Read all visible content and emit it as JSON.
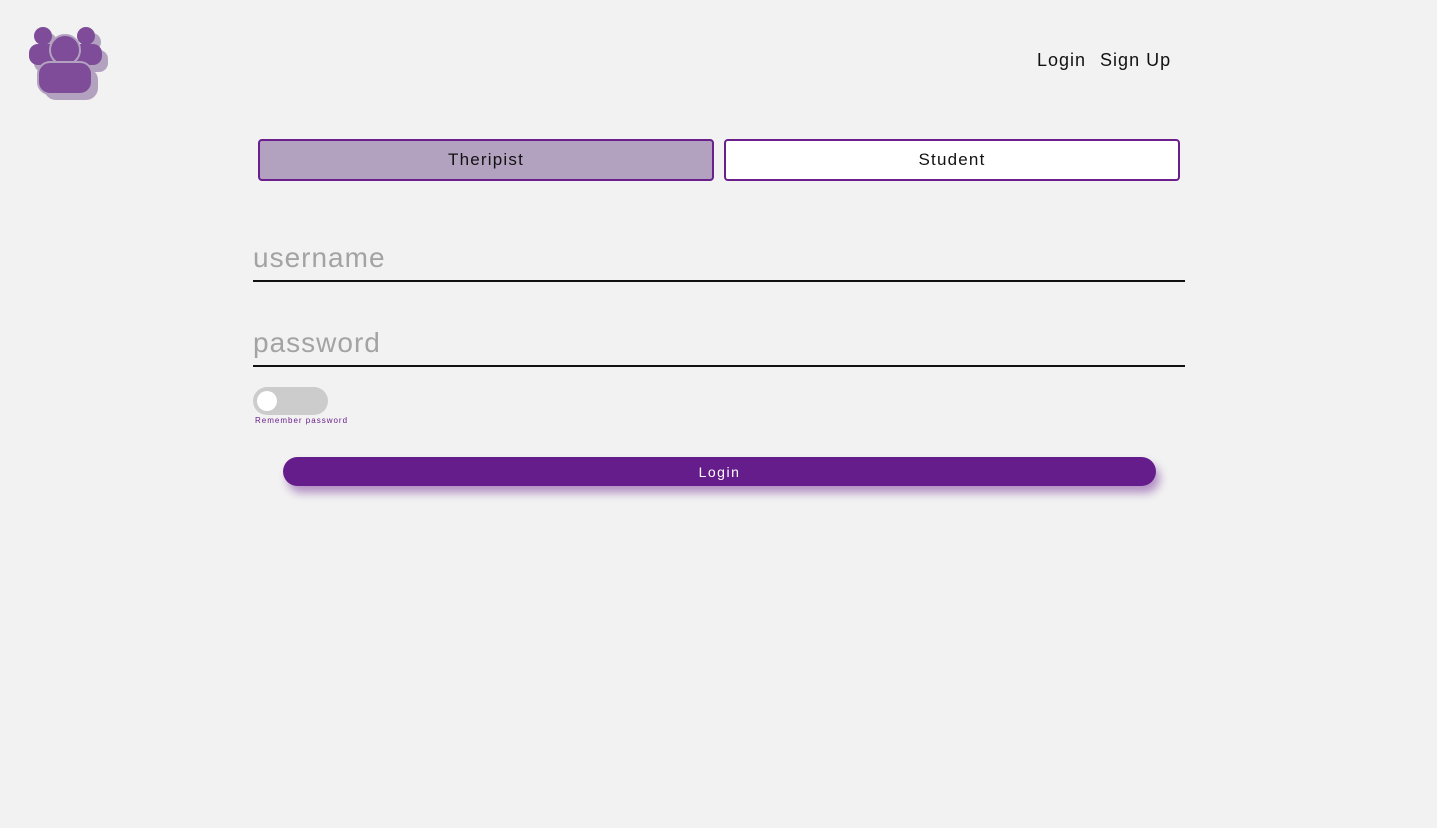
{
  "logo": {
    "icon": "group-users-icon"
  },
  "nav": {
    "login_label": "Login",
    "signup_label": "Sign Up"
  },
  "role_toggle": {
    "therapist_label": "Theripist",
    "student_label": "Student",
    "selected": "Theripist"
  },
  "form": {
    "username_placeholder": "username",
    "username_value": "",
    "password_placeholder": "password",
    "password_value": "",
    "remember_label": "Remember password",
    "remember_checked": false,
    "submit_label": "Login"
  },
  "colors": {
    "accent": "#661d8c",
    "selected_role_bg": "#b3a2bf",
    "page_bg": "#f2f2f2"
  }
}
